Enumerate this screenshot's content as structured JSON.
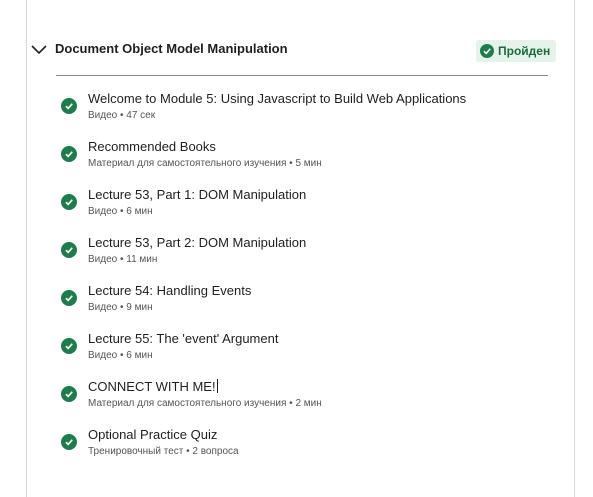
{
  "module": {
    "title": "Document Object Model Manipulation",
    "status": "Пройден",
    "expanded": true,
    "accent": "#1e7d4a"
  },
  "items": [
    {
      "title": "Welcome to Module 5: Using Javascript to Build Web Applications",
      "meta": "Видео • 47 сек"
    },
    {
      "title": "Recommended Books",
      "meta": "Материал для самостоятельного изучения • 5 мин"
    },
    {
      "title": "Lecture 53, Part 1: DOM Manipulation",
      "meta": "Видео • 6 мин"
    },
    {
      "title": "Lecture 53, Part 2: DOM Manipulation",
      "meta": "Видео • 11 мин"
    },
    {
      "title": "Lecture 54: Handling Events",
      "meta": "Видео • 9 мин"
    },
    {
      "title": "Lecture 55: The 'event' Argument",
      "meta": "Видео • 6 мин"
    },
    {
      "title": "CONNECT WITH ME!",
      "meta": "Материал для самостоятельного изучения • 2 мин"
    },
    {
      "title": "Optional Practice Quiz",
      "meta": "Тренировочный тест • 2 вопроса"
    }
  ]
}
